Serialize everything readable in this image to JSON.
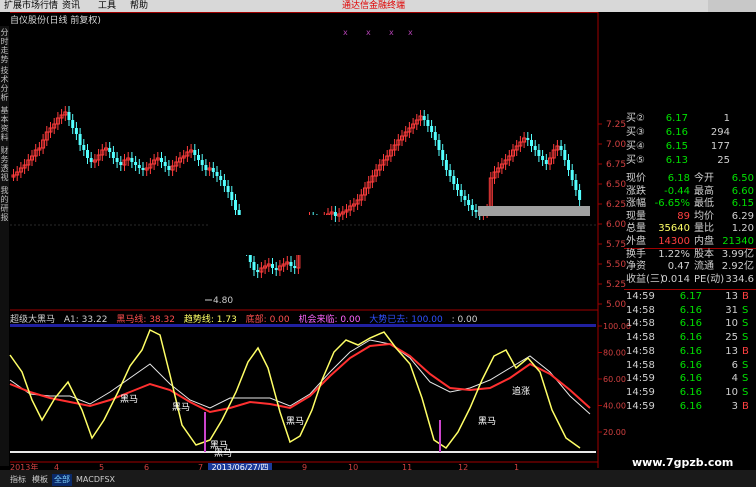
{
  "menu": {
    "items": [
      "扩展市场行情",
      "资讯",
      "工具",
      "帮助"
    ],
    "hint": "通达信金融终端"
  },
  "stock_title": "自仪股份(日线 前复权)",
  "left_tabs": [
    "分时走势",
    "技术分析",
    "基本资料",
    "财务透视",
    "我的研报"
  ],
  "price_axis": [
    "7.25",
    "7.00",
    "6.75",
    "6.50",
    "6.25",
    "6.00",
    "5.75",
    "5.50",
    "5.25",
    "5.00"
  ],
  "ind_axis": [
    "100.00",
    "80.00",
    "60.00",
    "40.00",
    "20.00"
  ],
  "low_marker": "4.80",
  "indicator": {
    "name": "超级大黑马",
    "a1": "A1: 33.22",
    "heima": "黑马线: 38.32",
    "qushi": "趋势线: 1.73",
    "dibu": "底部: 0.00",
    "jihui": "机会来临: 0.00",
    "dashi": "大势已去: 100.00",
    "end": ": 0.00"
  },
  "chart_labels": [
    "黑马",
    "黑马",
    "黑马",
    "黑马",
    "黑马",
    "黑马",
    "追涨"
  ],
  "date_axis": [
    "2013年",
    "4",
    "5",
    "6",
    "7",
    "8",
    "9",
    "10",
    "11",
    "12",
    "1"
  ],
  "date_cursor": "2013/06/27/四",
  "quote": {
    "bids": [
      {
        "label": "买②",
        "price": "6.17",
        "vol": "1"
      },
      {
        "label": "买③",
        "price": "6.16",
        "vol": "294"
      },
      {
        "label": "买④",
        "price": "6.15",
        "vol": "177"
      },
      {
        "label": "买⑤",
        "price": "6.13",
        "vol": "25"
      }
    ],
    "stats": [
      {
        "l1": "现价",
        "v1": "6.18",
        "l2": "今开",
        "v2": "6.50"
      },
      {
        "l1": "涨跌",
        "v1": "-0.44",
        "l2": "最高",
        "v2": "6.60"
      },
      {
        "l1": "涨幅",
        "v1": "-6.65%",
        "l2": "最低",
        "v2": "6.15"
      },
      {
        "l1": "现量",
        "v1": "89",
        "l2": "均价",
        "v2": "6.29"
      },
      {
        "l1": "总量",
        "v1": "35640",
        "l2": "量比",
        "v2": "1.20"
      },
      {
        "l1": "外盘",
        "v1": "14300",
        "l2": "内盘",
        "v2": "21340"
      },
      {
        "l1": "换手",
        "v1": "1.22%",
        "l2": "股本",
        "v2": "3.99亿"
      },
      {
        "l1": "净资",
        "v1": "0.47",
        "l2": "流通",
        "v2": "2.92亿"
      },
      {
        "l1": "收益(三)",
        "v1": "0.014",
        "l2": "PE(动)",
        "v2": "334.6"
      }
    ],
    "ticks": [
      {
        "time": "14:59",
        "price": "6.17",
        "vol": "13",
        "side": "B"
      },
      {
        "time": "14:58",
        "price": "6.16",
        "vol": "31",
        "side": "S"
      },
      {
        "time": "14:58",
        "price": "6.16",
        "vol": "10",
        "side": "S"
      },
      {
        "time": "14:58",
        "price": "6.16",
        "vol": "25",
        "side": "S"
      },
      {
        "time": "14:58",
        "price": "6.16",
        "vol": "13",
        "side": "B"
      },
      {
        "time": "14:58",
        "price": "6.16",
        "vol": "6",
        "side": "S"
      },
      {
        "time": "14:59",
        "price": "6.16",
        "vol": "4",
        "side": "S"
      },
      {
        "time": "14:59",
        "price": "6.16",
        "vol": "10",
        "side": "S"
      },
      {
        "time": "14:59",
        "price": "6.16",
        "vol": "3",
        "side": "B"
      }
    ]
  },
  "bottom_tabs": [
    "指标",
    "模板",
    "全部",
    "MACD",
    "FSX"
  ],
  "watermark": "www.7gpzb.com",
  "colors": {
    "up": "#ff3c3c",
    "down": "#54ffff",
    "yellow": "#ffff66",
    "green": "#00e000",
    "axis_red": "#a00000"
  }
}
